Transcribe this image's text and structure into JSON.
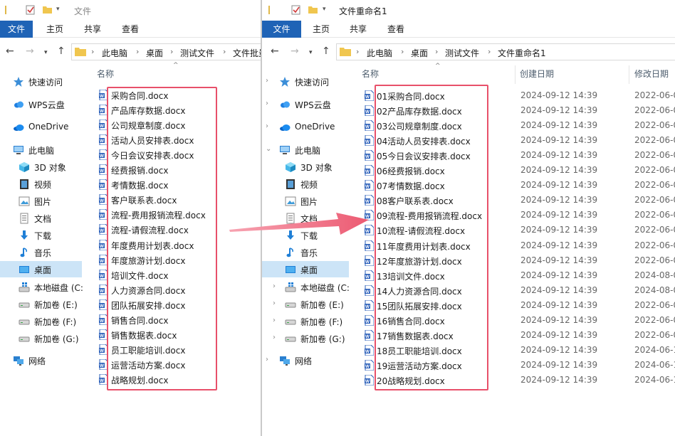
{
  "left_window": {
    "title": "文件",
    "ribbon_tabs": [
      "文件",
      "主页",
      "共享",
      "查看"
    ],
    "breadcrumb": [
      "此电脑",
      "桌面",
      "测试文件",
      "文件批量"
    ],
    "column_name": "名称",
    "nav_items": [
      {
        "label": "快速访问",
        "icon": "star-icon"
      },
      {
        "label": "WPS云盘",
        "icon": "cloud-icon"
      },
      {
        "label": "OneDrive",
        "icon": "onedrive-icon"
      },
      {
        "label": "此电脑",
        "icon": "computer-icon"
      },
      {
        "label": "3D 对象",
        "icon": "cube-icon"
      },
      {
        "label": "视频",
        "icon": "video-icon"
      },
      {
        "label": "图片",
        "icon": "picture-icon"
      },
      {
        "label": "文档",
        "icon": "document-icon"
      },
      {
        "label": "下载",
        "icon": "download-icon"
      },
      {
        "label": "音乐",
        "icon": "music-icon"
      },
      {
        "label": "桌面",
        "icon": "desktop-icon"
      },
      {
        "label": "本地磁盘 (C:",
        "icon": "windows-drive-icon"
      },
      {
        "label": "新加卷 (E:)",
        "icon": "drive-icon"
      },
      {
        "label": "新加卷 (F:)",
        "icon": "drive-icon"
      },
      {
        "label": "新加卷 (G:)",
        "icon": "drive-icon"
      },
      {
        "label": "网络",
        "icon": "network-icon"
      }
    ],
    "files": [
      "采购合同.docx",
      "产品库存数据.docx",
      "公司规章制度.docx",
      "活动人员安排表.docx",
      "今日会议安排表.docx",
      "经费报销.docx",
      "考情数据.docx",
      "客户联系表.docx",
      "流程-费用报销流程.docx",
      "流程-请假流程.docx",
      "年度费用计划表.docx",
      "年度旅游计划.docx",
      "培训文件.docx",
      "人力资源合同.docx",
      "团队拓展安排.docx",
      "销售合同.docx",
      "销售数据表.docx",
      "员工职能培训.docx",
      "运营活动方案.docx",
      "战略规划.docx"
    ]
  },
  "right_window": {
    "title": "文件重命名1",
    "ribbon_tabs": [
      "文件",
      "主页",
      "共享",
      "查看"
    ],
    "breadcrumb": [
      "此电脑",
      "桌面",
      "测试文件",
      "文件重命名1"
    ],
    "columns": [
      "名称",
      "创建日期",
      "修改日期"
    ],
    "nav_items": [
      {
        "label": "快速访问",
        "icon": "star-icon"
      },
      {
        "label": "WPS云盘",
        "icon": "cloud-icon"
      },
      {
        "label": "OneDrive",
        "icon": "onedrive-icon"
      },
      {
        "label": "此电脑",
        "icon": "computer-icon"
      },
      {
        "label": "3D 对象",
        "icon": "cube-icon"
      },
      {
        "label": "视频",
        "icon": "video-icon"
      },
      {
        "label": "图片",
        "icon": "picture-icon"
      },
      {
        "label": "文档",
        "icon": "document-icon"
      },
      {
        "label": "下载",
        "icon": "download-icon"
      },
      {
        "label": "音乐",
        "icon": "music-icon"
      },
      {
        "label": "桌面",
        "icon": "desktop-icon"
      },
      {
        "label": "本地磁盘 (C:",
        "icon": "windows-drive-icon"
      },
      {
        "label": "新加卷 (E:)",
        "icon": "drive-icon"
      },
      {
        "label": "新加卷 (F:)",
        "icon": "drive-icon"
      },
      {
        "label": "新加卷 (G:)",
        "icon": "drive-icon"
      },
      {
        "label": "网络",
        "icon": "network-icon"
      }
    ],
    "files": [
      {
        "name": "01采购合同.docx",
        "created": "2024-09-12 14:39",
        "modified": "2022-06-0"
      },
      {
        "name": "02产品库存数据.docx",
        "created": "2024-09-12 14:39",
        "modified": "2022-06-0"
      },
      {
        "name": "03公司规章制度.docx",
        "created": "2024-09-12 14:39",
        "modified": "2022-06-0"
      },
      {
        "name": "04活动人员安排表.docx",
        "created": "2024-09-12 14:39",
        "modified": "2022-06-0"
      },
      {
        "name": "05今日会议安排表.docx",
        "created": "2024-09-12 14:39",
        "modified": "2022-06-0"
      },
      {
        "name": "06经费报销.docx",
        "created": "2024-09-12 14:39",
        "modified": "2022-06-0"
      },
      {
        "name": "07考情数据.docx",
        "created": "2024-09-12 14:39",
        "modified": "2022-06-0"
      },
      {
        "name": "08客户联系表.docx",
        "created": "2024-09-12 14:39",
        "modified": "2022-06-0"
      },
      {
        "name": "09流程-费用报销流程.docx",
        "created": "2024-09-12 14:39",
        "modified": "2022-06-0"
      },
      {
        "name": "10流程-请假流程.docx",
        "created": "2024-09-12 14:39",
        "modified": "2022-06-0"
      },
      {
        "name": "11年度费用计划表.docx",
        "created": "2024-09-12 14:39",
        "modified": "2022-06-0"
      },
      {
        "name": "12年度旅游计划.docx",
        "created": "2024-09-12 14:39",
        "modified": "2022-06-0"
      },
      {
        "name": "13培训文件.docx",
        "created": "2024-09-12 14:39",
        "modified": "2024-08-0"
      },
      {
        "name": "14人力资源合同.docx",
        "created": "2024-09-12 14:39",
        "modified": "2024-08-0"
      },
      {
        "name": "15团队拓展安排.docx",
        "created": "2024-09-12 14:39",
        "modified": "2022-06-0"
      },
      {
        "name": "16销售合同.docx",
        "created": "2024-09-12 14:39",
        "modified": "2022-06-0"
      },
      {
        "name": "17销售数据表.docx",
        "created": "2024-09-12 14:39",
        "modified": "2022-06-0"
      },
      {
        "name": "18员工职能培训.docx",
        "created": "2024-09-12 14:39",
        "modified": "2024-06-1"
      },
      {
        "name": "19运营活动方案.docx",
        "created": "2024-09-12 14:39",
        "modified": "2024-06-1"
      },
      {
        "name": "20战略规划.docx",
        "created": "2024-09-12 14:39",
        "modified": "2024-06-1"
      }
    ]
  },
  "colors": {
    "ribbon_file_tab": "#1f63b6",
    "selection": "#cce4f7",
    "highlight_box": "#e8506a",
    "arrow": "#ec5a72",
    "word_icon": "#2b5fb9"
  }
}
